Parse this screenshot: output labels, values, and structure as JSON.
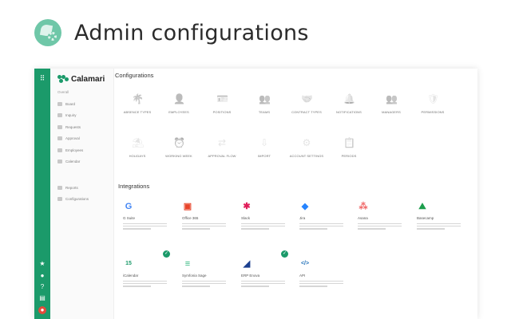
{
  "hero": {
    "title": "Admin configurations"
  },
  "brand": {
    "name": "Calamari"
  },
  "sidebar": {
    "section_label": "Overall",
    "items": [
      {
        "label": "Board",
        "icon": "board-icon"
      },
      {
        "label": "Inquiry",
        "icon": "inquiry-icon"
      },
      {
        "label": "Requests",
        "icon": "requests-icon"
      },
      {
        "label": "Approval",
        "icon": "approval-icon"
      },
      {
        "label": "Employees",
        "icon": "employees-icon"
      },
      {
        "label": "Calendar",
        "icon": "calendar-icon"
      }
    ],
    "bottom_items": [
      {
        "label": "Reports",
        "icon": "reports-icon"
      },
      {
        "label": "Configurations",
        "icon": "configurations-icon"
      }
    ]
  },
  "configurations": {
    "title": "Configurations",
    "tiles": [
      {
        "label": "ABSENCE TYPES",
        "icon": "palm-tree-icon",
        "glyph": "🌴"
      },
      {
        "label": "EMPLOYEES",
        "icon": "employee-card-icon",
        "glyph": "👤"
      },
      {
        "label": "POSITIONS",
        "icon": "id-card-icon",
        "glyph": "🪪"
      },
      {
        "label": "TEAMS",
        "icon": "team-icon",
        "glyph": "👥"
      },
      {
        "label": "CONTRACT TYPES",
        "icon": "handshake-icon",
        "glyph": "🤝"
      },
      {
        "label": "NOTIFICATIONS",
        "icon": "notification-user-icon",
        "glyph": "🔔"
      },
      {
        "label": "MANAGERS",
        "icon": "managers-icon",
        "glyph": "👥"
      },
      {
        "label": "PERMISSIONS",
        "icon": "shield-icon",
        "glyph": "🛡"
      },
      {
        "label": "HOLIDAYS",
        "icon": "holiday-icon",
        "glyph": "⛱"
      },
      {
        "label": "WORKING WEEK",
        "icon": "alarm-clock-icon",
        "glyph": "⏰"
      },
      {
        "label": "APPROVAL FLOW",
        "icon": "flow-arrows-icon",
        "glyph": "⇄"
      },
      {
        "label": "IMPORT",
        "icon": "import-icon",
        "glyph": "⇩"
      },
      {
        "label": "ACCOUNT SETTINGS",
        "icon": "gear-icon",
        "glyph": "⚙"
      },
      {
        "label": "PERIODS",
        "icon": "periods-icon",
        "glyph": "📋"
      }
    ]
  },
  "integrations": {
    "title": "Integrations",
    "cards": [
      {
        "name": "G Suite",
        "icon": "google-logo-icon",
        "glyph": "G",
        "color": "#4285f4",
        "connected": false
      },
      {
        "name": "Office 365",
        "icon": "office365-logo-icon",
        "glyph": "▣",
        "color": "#e8442a",
        "connected": false
      },
      {
        "name": "Slack",
        "icon": "slack-logo-icon",
        "glyph": "✱",
        "color": "#e01e5a",
        "connected": false
      },
      {
        "name": "Jira",
        "icon": "jira-logo-icon",
        "glyph": "◆",
        "color": "#2684ff",
        "connected": false
      },
      {
        "name": "Asana",
        "icon": "asana-logo-icon",
        "glyph": "⁂",
        "color": "#f06a6a",
        "connected": false
      },
      {
        "name": "Basecamp",
        "icon": "basecamp-logo-icon",
        "glyph": "⛰",
        "color": "#1d9e4d",
        "connected": false
      },
      {
        "name": "iCalendar",
        "icon": "icalendar-logo-icon",
        "glyph": "15",
        "color": "#1b9a6a",
        "connected": true
      },
      {
        "name": "Symfonia Sage",
        "icon": "symfonia-logo-icon",
        "glyph": "≡",
        "color": "#2fb67c",
        "connected": false
      },
      {
        "name": "ERP Enova",
        "icon": "erp-enova-logo-icon",
        "glyph": "◢",
        "color": "#1b3f8f",
        "connected": true
      },
      {
        "name": "API",
        "icon": "api-code-icon",
        "glyph": "</>",
        "color": "#1e6fb8",
        "connected": false
      }
    ]
  },
  "colors": {
    "accent": "#1b9a6a",
    "hero_logo": "#6fc7a8"
  }
}
